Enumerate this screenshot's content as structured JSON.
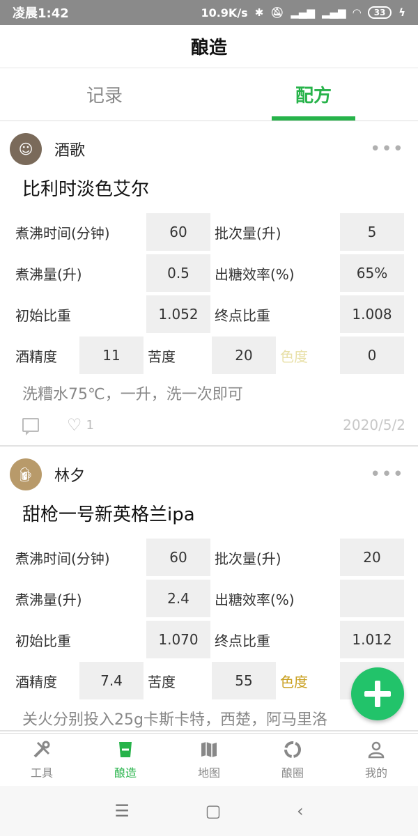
{
  "status_bar": {
    "time": "凌晨1:42",
    "speed": "10.9K/s",
    "battery": "33"
  },
  "header": {
    "title": "酿造"
  },
  "tabs": [
    {
      "label": "记录",
      "active": false
    },
    {
      "label": "配方",
      "active": true
    }
  ],
  "accent_color": "#27b34a",
  "posts": [
    {
      "author": "酒歌",
      "title": "比利时淡色艾尔",
      "fields": {
        "boil_time_label": "煮沸时间(分钟)",
        "boil_time": "60",
        "batch_label": "批次量(升)",
        "batch": "5",
        "boil_volume_label": "煮沸量(升)",
        "boil_volume": "0.5",
        "efficiency_label": "出糖效率(%)",
        "efficiency": "65%",
        "og_label": "初始比重",
        "og": "1.052",
        "fg_label": "终点比重",
        "fg": "1.008",
        "abv_label": "酒精度",
        "abv": "11",
        "ibu_label": "苦度",
        "ibu": "20",
        "color_label": "色度",
        "color": "0"
      },
      "note": "洗糟水75℃，一升，洗一次即可",
      "likes": "1",
      "date": "2020/5/2"
    },
    {
      "author": "林夕",
      "title": "甜枪一号新英格兰ipa",
      "fields": {
        "boil_time_label": "煮沸时间(分钟)",
        "boil_time": "60",
        "batch_label": "批次量(升)",
        "batch": "20",
        "boil_volume_label": "煮沸量(升)",
        "boil_volume": "2.4",
        "efficiency_label": "出糖效率(%)",
        "efficiency": "",
        "og_label": "初始比重",
        "og": "1.070",
        "fg_label": "终点比重",
        "fg": "1.012",
        "abv_label": "酒精度",
        "abv": "7.4",
        "ibu_label": "苦度",
        "ibu": "55",
        "color_label": "色度",
        "color": ""
      },
      "note": "关火分别投入25g卡斯卡特，西楚，阿马里洛"
    }
  ],
  "bottom_nav": [
    {
      "label": "工具",
      "icon": "tools-icon"
    },
    {
      "label": "酿造",
      "icon": "brew-cup-icon"
    },
    {
      "label": "地图",
      "icon": "map-icon"
    },
    {
      "label": "酿圈",
      "icon": "circle-icon"
    },
    {
      "label": "我的",
      "icon": "profile-icon"
    }
  ]
}
